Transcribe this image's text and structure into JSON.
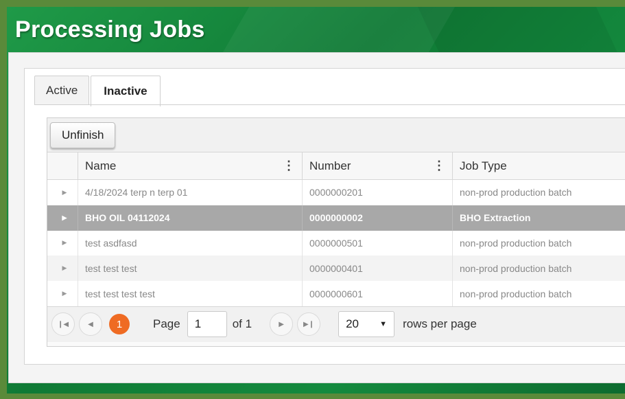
{
  "page": {
    "title": "Processing Jobs"
  },
  "tabs": [
    {
      "label": "Active"
    },
    {
      "label": "Inactive"
    }
  ],
  "toolbar": {
    "unfinish_label": "Unfinish"
  },
  "columns": {
    "name": "Name",
    "number": "Number",
    "job_type": "Job Type"
  },
  "rows": [
    {
      "name": "4/18/2024 terp n terp 01",
      "number": "0000000201",
      "job_type": "non-prod production batch"
    },
    {
      "name": "BHO OIL 04112024",
      "number": "0000000002",
      "job_type": "BHO Extraction"
    },
    {
      "name": "test asdfasd",
      "number": "0000000501",
      "job_type": "non-prod production batch"
    },
    {
      "name": "test test test",
      "number": "0000000401",
      "job_type": "non-prod production batch"
    },
    {
      "name": "test test test test",
      "number": "0000000601",
      "job_type": "non-prod production batch"
    }
  ],
  "pager": {
    "current_page": "1",
    "page_label": "Page",
    "page_input": "1",
    "of_label": "of 1",
    "rows_per_page": "20",
    "rows_per_page_label": "rows per page"
  },
  "icons": {
    "first": "first-page-icon",
    "prev": "prev-page-icon",
    "next": "next-page-icon",
    "last": "last-page-icon",
    "expand": "expand-arrow-icon",
    "column_menu": "column-menu-icon",
    "dropdown": "dropdown-caret-icon"
  },
  "colors": {
    "accent": "#ef6b23",
    "brand_green": "#148a3e",
    "selected_row": "#a8a8a8"
  }
}
